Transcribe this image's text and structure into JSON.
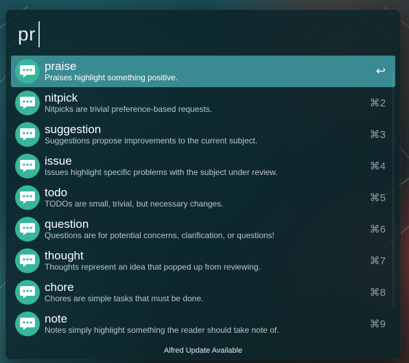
{
  "search": {
    "query": "pr"
  },
  "results": [
    {
      "title": "praise",
      "subtitle": "Praises highlight something positive.",
      "shortcut": "↩",
      "selected": true
    },
    {
      "title": "nitpick",
      "subtitle": "Nitpicks are trivial preference-based requests.",
      "shortcut": "⌘2"
    },
    {
      "title": "suggestion",
      "subtitle": "Suggestions propose improvements to the current subject.",
      "shortcut": "⌘3"
    },
    {
      "title": "issue",
      "subtitle": "Issues highlight specific problems with the subject under review.",
      "shortcut": "⌘4"
    },
    {
      "title": "todo",
      "subtitle": "TODOs are small, trivial, but necessary changes.",
      "shortcut": "⌘5"
    },
    {
      "title": "question",
      "subtitle": "Questions are for potential concerns, clarification, or questions!",
      "shortcut": "⌘6"
    },
    {
      "title": "thought",
      "subtitle": "Thoughts represent an idea that popped up from reviewing.",
      "shortcut": "⌘7"
    },
    {
      "title": "chore",
      "subtitle": "Chores are simple tasks that must be done.",
      "shortcut": "⌘8"
    },
    {
      "title": "note",
      "subtitle": "Notes simply highlight something the reader should take note of.",
      "shortcut": "⌘9"
    }
  ],
  "result_icon": "speech-bubble-icon",
  "footer": {
    "text": "Alfred Update Available"
  },
  "colors": {
    "selected_row": "#3a8a92",
    "icon_circle": "#36b69a",
    "window_background": "#0c242a"
  }
}
